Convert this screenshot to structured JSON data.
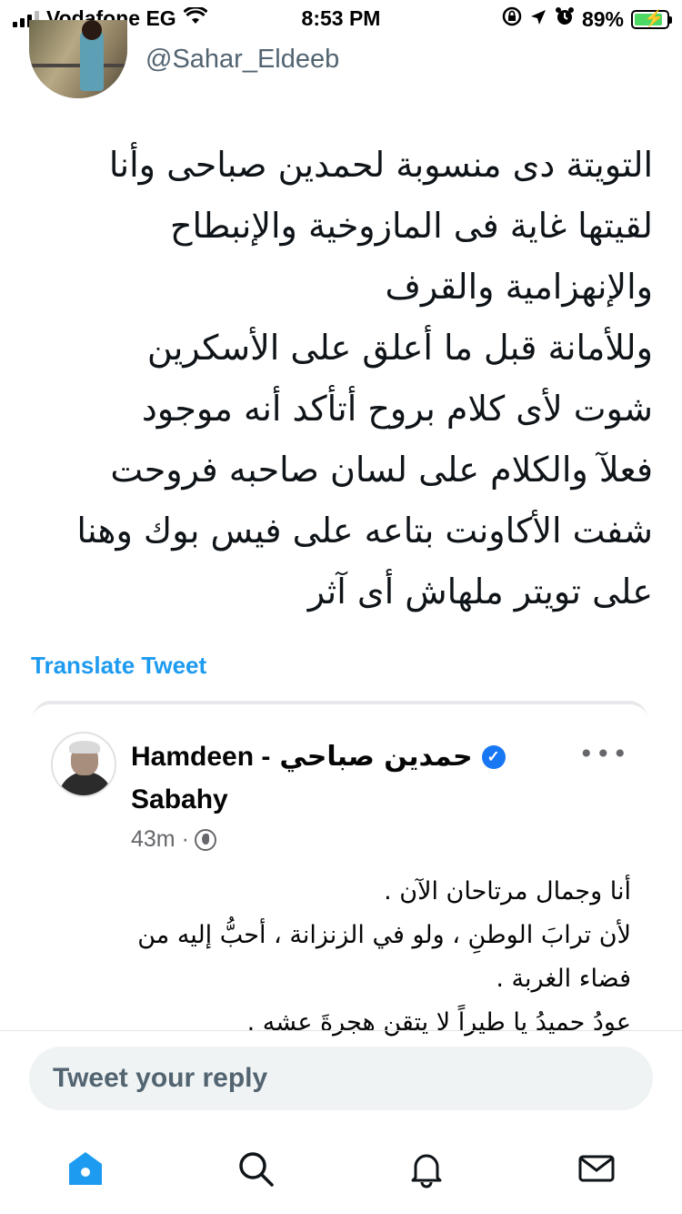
{
  "status_bar": {
    "carrier": "Vodafone EG",
    "time": "8:53 PM",
    "battery": "89%",
    "battery_level": 0.89,
    "icons": [
      "signal-icon",
      "wifi-icon",
      "screen-lock-icon",
      "location-icon",
      "alarm-icon",
      "battery-charging-icon"
    ]
  },
  "author": {
    "handle": "@Sahar_Eldeeb"
  },
  "tweet": {
    "lines": [
      "التويتة دى منسوبة لحمدين صباحى وأنا",
      "لقيتها غاية فى المازوخية والإنبطاح",
      "والإنهزامية والقرف",
      "وللأمانة قبل ما أعلق على الأسكرين",
      "شوت لأى كلام بروح أتأكد أنه موجود",
      "فعلآ والكلام على لسان صاحبه فروحت",
      "شفت الأكاونت بتاعه على فيس بوك وهنا",
      "على تويتر ملهاش أى آثر"
    ],
    "translate_label": "Translate Tweet"
  },
  "embed": {
    "name_latin_1": "Hamdeen -",
    "name_arabic": "حمدين  صباحي",
    "name_latin_2": "Sabahy",
    "time": "43m ·",
    "more": "•••",
    "lines": [
      "أنا وجمال مرتاحان الآن .",
      "لأن ترابَ الوطنِ ، ولو في الزنزانة ،  أحبُّ إليه من",
      "فضاء الغربة .",
      "عودُ حميدُ يا طيراً لا يتقن هجرةَ عشه ."
    ]
  },
  "reply": {
    "placeholder": "Tweet your reply"
  },
  "tabs": [
    {
      "name": "home",
      "icon": "home-icon",
      "active": true
    },
    {
      "name": "search",
      "icon": "search-icon",
      "active": false
    },
    {
      "name": "notifications",
      "icon": "bell-icon",
      "active": false
    },
    {
      "name": "messages",
      "icon": "mail-icon",
      "active": false
    }
  ],
  "colors": {
    "accent": "#1d9bf0",
    "text": "#0f1419",
    "muted": "#536471",
    "fb_blue": "#1877f2",
    "battery_green": "#4cd964"
  }
}
